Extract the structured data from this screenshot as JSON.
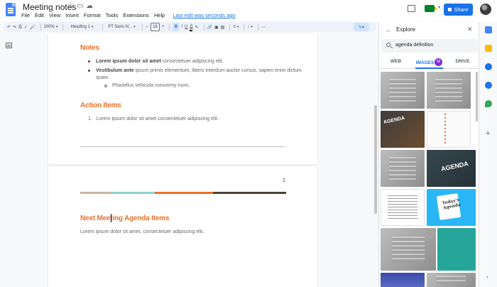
{
  "window": {
    "doc_title": "Meeting notes",
    "menu": [
      "File",
      "Edit",
      "View",
      "Insert",
      "Format",
      "Tools",
      "Extensions",
      "Help"
    ],
    "last_edit": "Last edit was seconds ago",
    "share_label": "Share"
  },
  "toolbar": {
    "zoom": "100%",
    "style": "Heading 1",
    "font": "PT Sans N...",
    "font_size": "18",
    "bold": "B",
    "italic": "I",
    "underline": "U",
    "text_color": "A"
  },
  "document": {
    "notes_heading": "Notes",
    "bullet1_bold": "Lorem ipsum dolor sit amet",
    "bullet1_rest": " consectetuer adipiscing elit.",
    "bullet2_bold": "Vestibulum ante",
    "bullet2_rest": " ipsum primis elementum, libero interdum auctor cursus, sapien enim dictum quam.",
    "sub_bullet": "Phasellus vehicula nonummy nunc.",
    "action_heading": "Action Items",
    "action_item": "1.   Lorem ipsum dolor sit amet consectetuer adipiscing elit.",
    "page_number": "2",
    "next_heading": "Next Meeting Agenda Items",
    "next_body": "Lorem ipsum dolor sit amet, consectetuer adipiscing elit.",
    "accent_color": "#e8712b",
    "bar_colors": [
      "#c8b79a",
      "#8fd3cc",
      "#e8712b",
      "#4a4438"
    ]
  },
  "explore": {
    "title": "Explore",
    "search_value": "agenda definition",
    "tabs": [
      "WEB",
      "IMAGES",
      "DRIVE"
    ],
    "active_tab": "IMAGES",
    "thumb_texts": {
      "agenda_dark": "AGENDA",
      "agenda_chalk": "AGENDA",
      "todays_agenda": "Today's Agenda"
    }
  }
}
